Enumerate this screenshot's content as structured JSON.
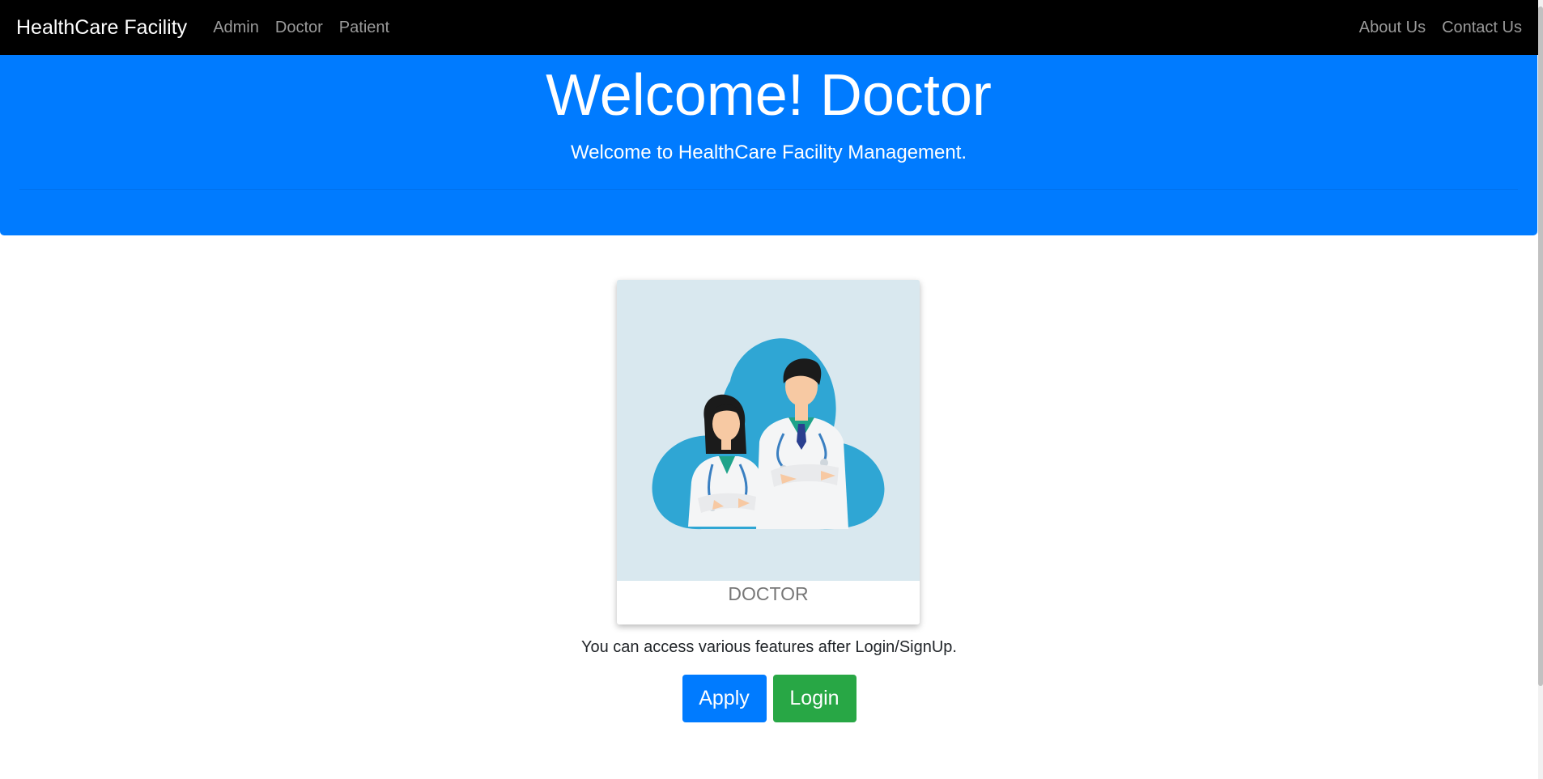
{
  "navbar": {
    "brand": "HealthCare Facility",
    "links": [
      "Admin",
      "Doctor",
      "Patient"
    ],
    "right_links": [
      "About Us",
      "Contact Us"
    ]
  },
  "jumbotron": {
    "title": "Welcome! Doctor",
    "subtitle": "Welcome to HealthCare Facility Management."
  },
  "card": {
    "image_icon": "doctors-illustration",
    "label": "DOCTOR"
  },
  "info_text": "You can access various features after Login/SignUp.",
  "buttons": {
    "apply": "Apply",
    "login": "Login"
  },
  "colors": {
    "navbar_bg": "#000000",
    "jumbotron_bg": "#007bff",
    "apply_bg": "#007bff",
    "login_bg": "#28a745",
    "illustration_bg": "#d9e8ef",
    "blob": "#2fa6d4"
  }
}
